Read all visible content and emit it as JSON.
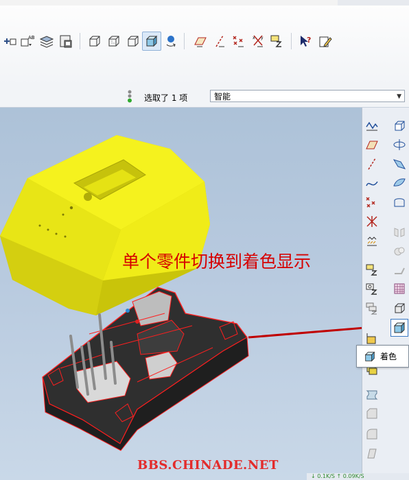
{
  "status": {
    "selection_text": "选取了 1 项",
    "filter_value": "智能"
  },
  "annotation": {
    "text": "单个零件切换到着色显示"
  },
  "watermark": {
    "text": "BBS.CHINADE.NET"
  },
  "tooltip": {
    "label": "着色"
  },
  "network": {
    "text": "↓ 0.1K/S   ↑ 0.09K/S"
  },
  "toolbar": {
    "buttons": [
      "insert-feature-icon",
      "rename-feature-icon",
      "layers-icon",
      "model-tree-icon",
      "wireframe-icon",
      "hidden-line-icon",
      "no-hidden-icon",
      "shading-icon",
      "spin-center-icon",
      "datum-planes-icon",
      "datum-axes-icon",
      "datum-points-icon",
      "coordinate-systems-icon",
      "annotations-icon",
      "context-help-icon",
      "edit-pencil-icon"
    ]
  },
  "colors": {
    "part_yellow": "#f2ef1a",
    "part_dark": "#3a3a3a",
    "edge_red": "#ff1f1f",
    "annotation_red": "#d60000",
    "arrow_red": "#c00000"
  }
}
